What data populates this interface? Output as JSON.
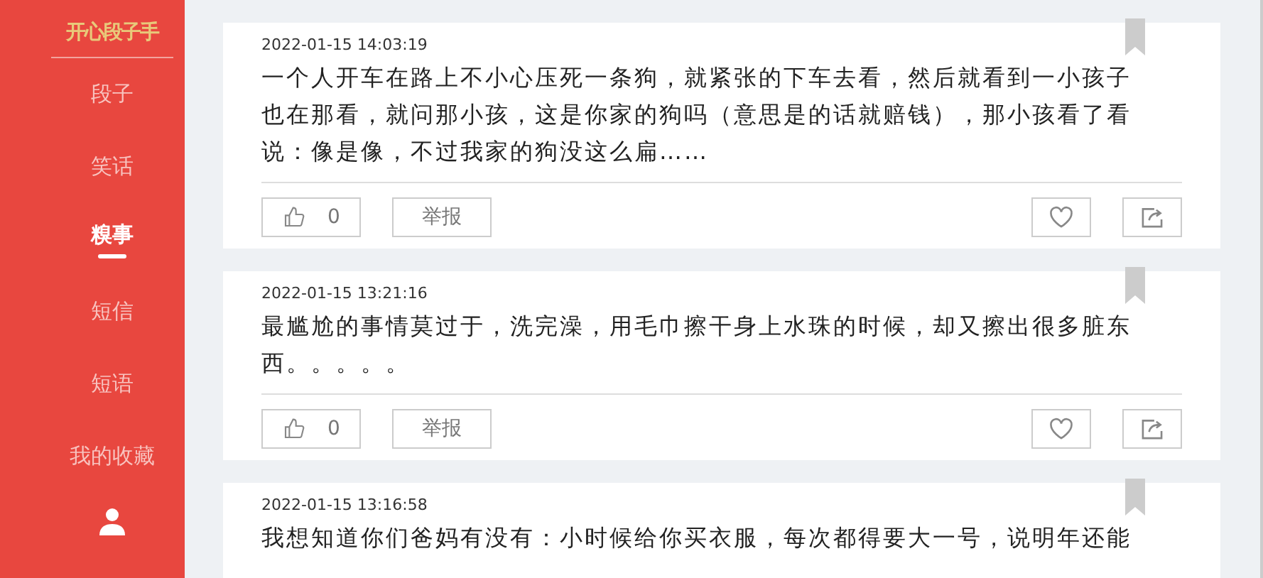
{
  "logo": "开心段子手",
  "nav": [
    {
      "label": "段子",
      "selected": false
    },
    {
      "label": "笑话",
      "selected": false
    },
    {
      "label": "糗事",
      "selected": true
    },
    {
      "label": "短信",
      "selected": false
    },
    {
      "label": "短语",
      "selected": false
    },
    {
      "label": "我的收藏",
      "selected": false
    }
  ],
  "posts": [
    {
      "time": "2022-01-15 14:03:19",
      "text": "一个人开车在路上不小心压死一条狗，就紧张的下车去看，然后就看到一小孩子也在那看，就问那小孩，这是你家的狗吗（意思是的话就赔钱），那小孩看了看说：像是像，不过我家的狗没这么扁……",
      "likes": "0",
      "report": "举报"
    },
    {
      "time": "2022-01-15 13:21:16",
      "text": "最尴尬的事情莫过于，洗完澡，用毛巾擦干身上水珠的时候，却又擦出很多脏东西。。。。。",
      "likes": "0",
      "report": "举报"
    },
    {
      "time": "2022-01-15 13:16:58",
      "text": "我想知道你们爸妈有没有：小时候给你买衣服，每次都得要大一号，说明年还能"
    }
  ]
}
